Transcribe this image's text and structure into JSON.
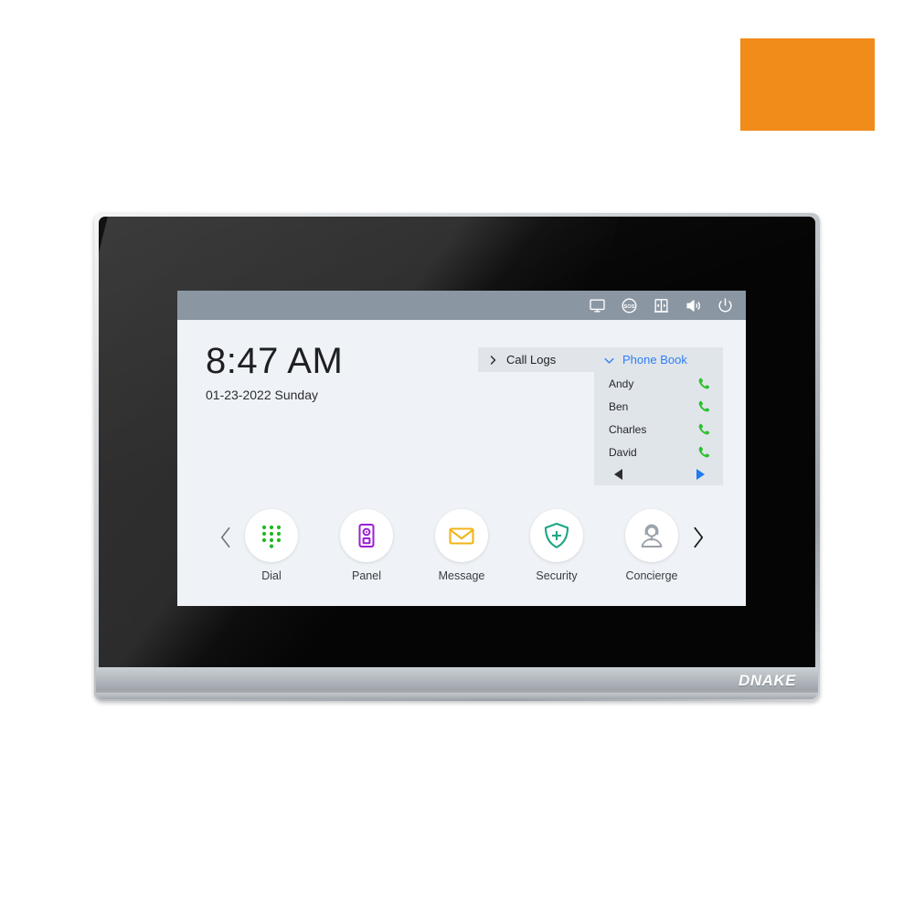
{
  "swatch": {
    "name": "color-swatch",
    "color": "#f18b1a"
  },
  "device": {
    "brand": "DNAKE",
    "type": "indoor-monitor"
  },
  "screen": {
    "status_bar": {
      "icons": [
        {
          "name": "monitor-icon",
          "label": "Monitor"
        },
        {
          "name": "sos-icon",
          "label": "SOS"
        },
        {
          "name": "door-icon",
          "label": "Door"
        },
        {
          "name": "volume-icon",
          "label": "Volume"
        },
        {
          "name": "power-icon",
          "label": "Power"
        }
      ]
    },
    "clock": {
      "time": "8:47 AM",
      "date": "01-23-2022 Sunday"
    },
    "contacts": {
      "call_logs": {
        "label": "Call Logs",
        "expanded": false,
        "chevron": "chevron-right-icon"
      },
      "phone_book": {
        "label": "Phone Book",
        "expanded": true,
        "chevron": "chevron-down-icon",
        "accent_color": "#2f7df6",
        "entries": [
          {
            "name": "Andy",
            "action": "call-icon"
          },
          {
            "name": "Ben",
            "action": "call-icon"
          },
          {
            "name": "Charles",
            "action": "call-icon"
          },
          {
            "name": "David",
            "action": "call-icon"
          }
        ],
        "pager": {
          "prev": "prev-page-arrow",
          "next": "next-page-arrow",
          "prev_color": "#2b2d30",
          "next_color": "#1f7bf0"
        }
      }
    },
    "dock": {
      "prev_arrow": "chevron-left-icon",
      "next_arrow": "chevron-right-icon",
      "apps": [
        {
          "label": "Dial",
          "icon": "keypad-icon",
          "color": "#22b922"
        },
        {
          "label": "Panel",
          "icon": "door-station-icon",
          "color": "#9b1ed6"
        },
        {
          "label": "Message",
          "icon": "envelope-icon",
          "color": "#f2b418"
        },
        {
          "label": "Security",
          "icon": "shield-plus-icon",
          "color": "#21a585"
        },
        {
          "label": "Concierge",
          "icon": "operator-icon",
          "color": "#9aa2ab"
        }
      ]
    }
  }
}
